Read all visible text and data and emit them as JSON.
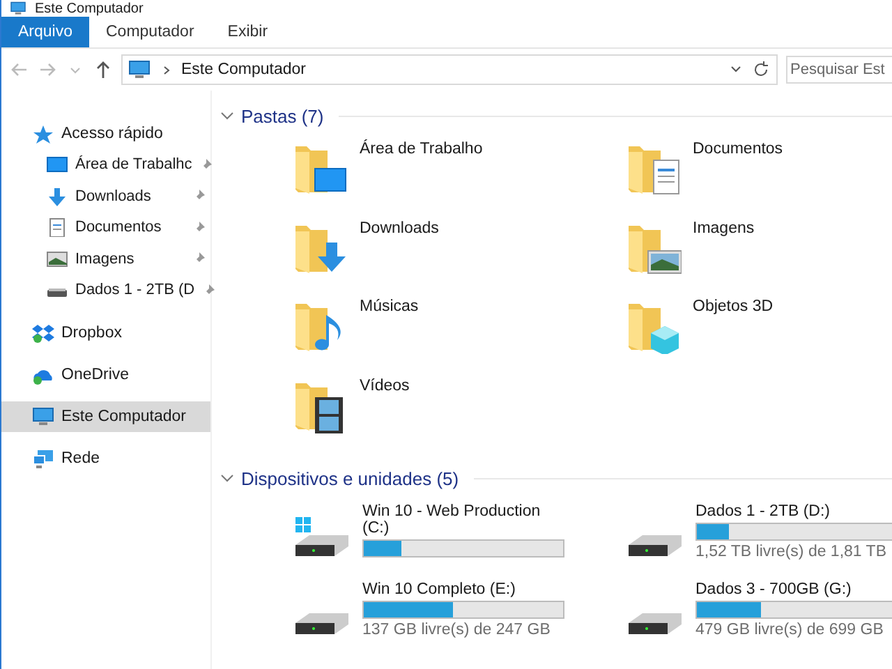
{
  "window": {
    "title": "Este Computador"
  },
  "ribbon_tabs": [
    {
      "label": "Arquivo",
      "selected": true
    },
    {
      "label": "Computador",
      "selected": false
    },
    {
      "label": "Exibir",
      "selected": false
    }
  ],
  "address_bar": {
    "path": "Este Computador"
  },
  "search": {
    "placeholder": "Pesquisar Est"
  },
  "sidebar": {
    "items": [
      {
        "label": "Acesso rápido",
        "kind": "star",
        "selected": false,
        "children": [
          {
            "label": "Área de Trabalhc",
            "kind": "desktop",
            "pinned": true
          },
          {
            "label": "Downloads",
            "kind": "downloads",
            "pinned": true
          },
          {
            "label": "Documentos",
            "kind": "documents",
            "pinned": true
          },
          {
            "label": "Imagens",
            "kind": "pictures",
            "pinned": true
          },
          {
            "label": "Dados 1 - 2TB (D",
            "kind": "drive",
            "pinned": true
          }
        ]
      },
      {
        "label": "Dropbox",
        "kind": "dropbox",
        "selected": false
      },
      {
        "label": "OneDrive",
        "kind": "onedrive",
        "selected": false
      },
      {
        "label": "Este Computador",
        "kind": "computer",
        "selected": true
      },
      {
        "label": "Rede",
        "kind": "network",
        "selected": false
      }
    ]
  },
  "folders": {
    "heading": "Pastas (7)",
    "expanded": true,
    "items": [
      {
        "label": "Área de Trabalho",
        "kind": "desktop"
      },
      {
        "label": "Documentos",
        "kind": "documents"
      },
      {
        "label": "Downloads",
        "kind": "downloads"
      },
      {
        "label": "Imagens",
        "kind": "pictures"
      },
      {
        "label": "Músicas",
        "kind": "music"
      },
      {
        "label": "Objetos 3D",
        "kind": "cube"
      },
      {
        "label": "Vídeos",
        "kind": "videos"
      }
    ]
  },
  "drives": {
    "heading": "Dispositivos e unidades (5)",
    "expanded": true,
    "items": [
      {
        "label": "Win 10 - Web Production (C:)",
        "kind": "system",
        "level": 0.19
      },
      {
        "label": "Dados 1 - 2TB (D:)",
        "kind": "hdd",
        "level": 0.16,
        "free": "1,52 TB livre(s) de 1,81 TB"
      },
      {
        "label": "Win 10 Completo (E:)",
        "kind": "hdd",
        "level": 0.45,
        "free": "137 GB livre(s) de 247 GB"
      },
      {
        "label": "Dados 3 - 700GB (G:)",
        "kind": "hdd",
        "level": 0.32,
        "free": "479 GB livre(s) de 699 GB"
      }
    ]
  }
}
